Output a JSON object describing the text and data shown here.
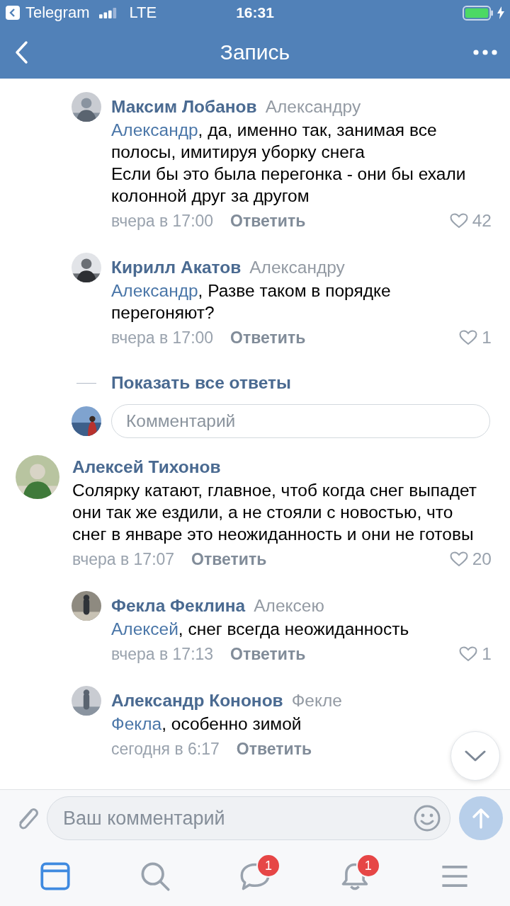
{
  "status_bar": {
    "back_app": "Telegram",
    "network": "LTE",
    "time": "16:31"
  },
  "nav": {
    "title": "Запись"
  },
  "feed": [
    {
      "kind": "reply",
      "author": "Максим Лобанов",
      "addressee": "Александру",
      "mention": "Александр",
      "text": ", да, именно так, занимая все полосы, имитируя уборку снега\nЕсли бы это была перегонка - они бы ехали колонной друг за другом",
      "time": "вчера в 17:00",
      "reply_label": "Ответить",
      "likes": "42"
    },
    {
      "kind": "reply",
      "author": "Кирилл Акатов",
      "addressee": "Александру",
      "mention": "Александр",
      "text": ", Разве таком в порядке перегоняют?",
      "time": "вчера в 17:00",
      "reply_label": "Ответить",
      "likes": "1"
    },
    {
      "kind": "show_all",
      "label": "Показать все ответы"
    },
    {
      "kind": "reply_input",
      "placeholder": "Комментарий"
    },
    {
      "kind": "comment",
      "author": "Алексей Тихонов",
      "text": "Солярку катают, главное, чтоб когда снег выпадет они так же ездили, а не стояли с новостью, что снег в январе это неожиданность и они не готовы",
      "time": "вчера в 17:07",
      "reply_label": "Ответить",
      "likes": "20",
      "children": [
        {
          "kind": "reply",
          "author": "Фекла Феклина",
          "addressee": "Алексею",
          "mention": "Алексей",
          "text": ", снег всегда неожиданность",
          "time": "вчера в 17:13",
          "reply_label": "Ответить",
          "likes": "1"
        },
        {
          "kind": "reply",
          "author": "Александр Кононов",
          "addressee": "Фекле",
          "mention": "Фекла",
          "text": ", особенно зимой",
          "time": "сегодня в 6:17",
          "reply_label": "Ответить"
        }
      ]
    }
  ],
  "composer": {
    "placeholder": "Ваш комментарий"
  },
  "tabs": [
    {
      "kind": "feed",
      "selected": true
    },
    {
      "kind": "search",
      "selected": false
    },
    {
      "kind": "messages",
      "selected": false,
      "badge": "1"
    },
    {
      "kind": "notifications",
      "selected": false,
      "badge": "1"
    },
    {
      "kind": "menu",
      "selected": false
    }
  ]
}
